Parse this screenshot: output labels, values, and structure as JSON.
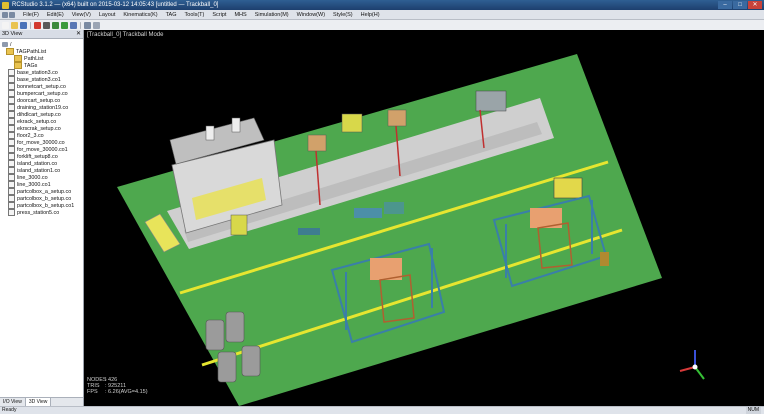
{
  "window": {
    "title": "RCStudio 3.1.2 — (x64) built on 2015-03-12 14:05:43  [untitled — Trackball_0]",
    "minimize": "–",
    "maximize": "□",
    "close": "✕"
  },
  "menu": [
    "File(F)",
    "Edit(E)",
    "View(V)",
    "Layout",
    "Kinematics(K)",
    "TAG",
    "Tools(T)",
    "Script",
    "MHS",
    "Simulation(M)",
    "Window(W)",
    "Style(S)",
    "Help(H)"
  ],
  "toolbar": {
    "icons": [
      {
        "name": "new-icon",
        "color": "#f4f4f4"
      },
      {
        "name": "open-icon",
        "color": "#e9c350"
      },
      {
        "name": "save-icon",
        "color": "#4a72b8"
      },
      {
        "name": "sep"
      },
      {
        "name": "record-icon",
        "color": "#d23a2f"
      },
      {
        "name": "stop-icon",
        "color": "#5a5a5a"
      },
      {
        "name": "rewind-icon",
        "color": "#3c8a3c"
      },
      {
        "name": "play-icon",
        "color": "#3c9a3c"
      },
      {
        "name": "pause-icon",
        "color": "#5a78b5"
      },
      {
        "name": "sep"
      },
      {
        "name": "camera-icon",
        "color": "#7a8aa2"
      },
      {
        "name": "grid-icon",
        "color": "#9aa4b4"
      }
    ]
  },
  "sidebar": {
    "panel_title": "3D View",
    "close": "✕",
    "root": "/",
    "taglist": "TAGPathList",
    "pathlist": "PathList",
    "tags": "TAGs",
    "files": [
      "base_station3.co",
      "base_station3.co1",
      "bonnetcart_setup.co",
      "bumpercart_setup.co",
      "doorcart_setup.co",
      "draining_station19.co",
      "dihdlcart_setup.co",
      "ekrack_setup.co",
      "ekrscrak_setup.co",
      "floor2_3.co",
      "for_move_30000.co",
      "for_move_30000.co1",
      "forklift_setup8.co",
      "island_station.co",
      "island_station1.co",
      "line_3000.co",
      "line_3000.co1",
      "partcolbox_a_setup.co",
      "partcolbox_b_setup.co",
      "partcolbox_b_setup.co1",
      "press_station5.co"
    ],
    "tabs": [
      "I/O View",
      "3D View"
    ]
  },
  "viewport": {
    "header": "[Trackball_0] Trackball Mode",
    "stats": [
      {
        "key": "NODES",
        "value": ": 426"
      },
      {
        "key": "TRIS",
        "value": ": 925211"
      },
      {
        "key": "FPS",
        "value": ": 6.26(AVG=4.15)"
      }
    ],
    "colors": {
      "background": "#000000",
      "floor": "#4ea84e",
      "walkway": "#cfcfcf",
      "lane_marking": "#e6e630",
      "frame": "#3a7fa8",
      "accent": "#e8a070"
    }
  },
  "status": {
    "left": "Ready",
    "right": "NUM"
  }
}
